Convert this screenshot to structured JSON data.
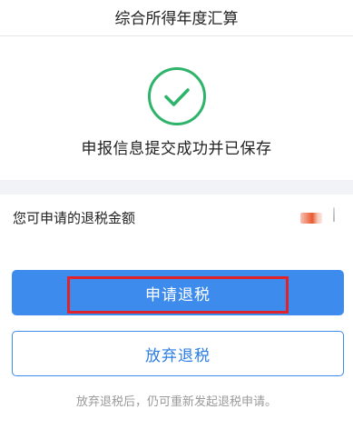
{
  "header": {
    "title": "综合所得年度汇算"
  },
  "success": {
    "icon": "check-circle-icon",
    "message": "申报信息提交成功并已保存"
  },
  "refund": {
    "label": "您可申请的退税金额"
  },
  "actions": {
    "apply_label": "申请退税",
    "give_up_label": "放弃退税",
    "hint": "放弃退税后，仍可重新发起退税申请。"
  },
  "colors": {
    "success_green": "#2db36a",
    "primary_blue": "#3d8bec",
    "highlight_red": "#e0232b"
  }
}
